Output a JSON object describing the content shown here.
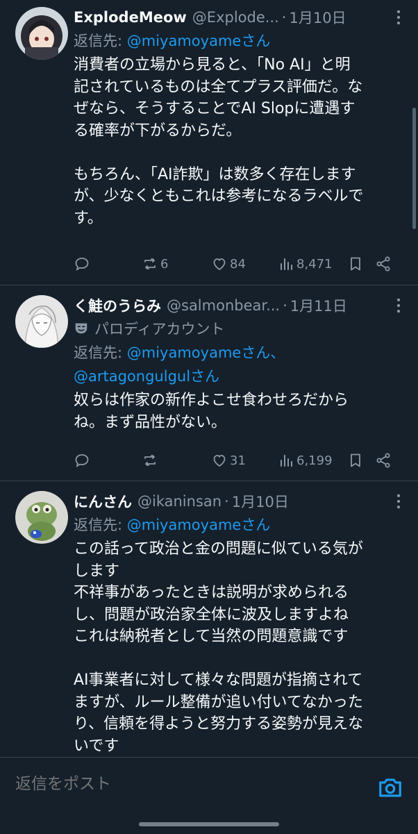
{
  "tweets": [
    {
      "name": "ExplodeMeow",
      "handle": "@Explode...",
      "dot": "·",
      "date": "1月10日",
      "reply_prefix": "返信先: ",
      "reply_mentions": "@miyamoyameさん",
      "text": "消費者の立場から見ると、「No AI」と明\n記されているものは全てプラス評価だ。な\nぜなら、そうすることでAI Slopに遭遇す\nる確率が下がるからだ。\n\nもちろん、「AI詐欺」は数多く存在します\nが、少なくともこれは参考になるラベルで\nす。",
      "replies": "",
      "retweets": "6",
      "likes": "84",
      "views": "8,471"
    },
    {
      "name": "く鮭のうらみ",
      "handle": "@salmonbear...",
      "dot": "·",
      "date": "1月11日",
      "label": "パロディアカウント",
      "reply_prefix": "返信先: ",
      "reply_mentions_1": "@miyamoyameさん、",
      "reply_mentions_2": "@artagongulgulさん",
      "text": "奴らは作家の新作よこせ食わせろだから\nね。まず品性がない。",
      "replies": "",
      "retweets": "",
      "likes": "31",
      "views": "6,199"
    },
    {
      "name": "にんさん",
      "handle": "@ikaninsan",
      "dot": "·",
      "date": "1月10日",
      "reply_prefix": "返信先: ",
      "reply_mentions": "@miyamoyameさん",
      "text": "この話って政治と金の問題に似ている気が\nします\n不祥事があったときは説明が求められる\nし、問題が政治家全体に波及しますよね\nこれは納税者として当然の問題意識です\n\nAI事業者に対して様々な問題が指摘されて\nますが、ルール整備が追い付いてなかった\nり、信頼を得ようと努力する姿勢が見えな\nいです"
    }
  ],
  "composer": {
    "placeholder": "返信をポスト"
  },
  "colors": {
    "background": "#15202b",
    "accent": "#1d9bf0",
    "muted": "#8b98a5",
    "divider": "#38444d"
  },
  "icons": [
    "reply-icon",
    "retweet-icon",
    "like-icon",
    "views-icon",
    "bookmark-icon",
    "share-icon",
    "more-icon",
    "parody-mask-icon",
    "camera-icon"
  ]
}
